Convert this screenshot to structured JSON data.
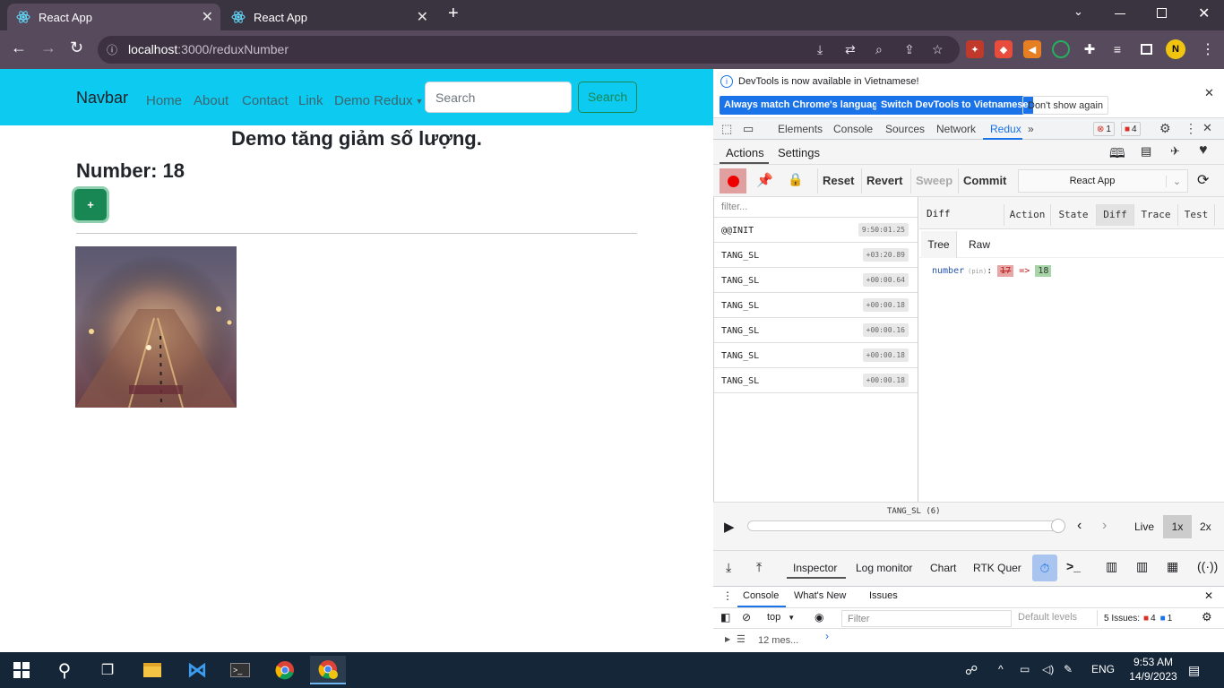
{
  "browser": {
    "tabs": [
      {
        "title": "React App",
        "active": true
      },
      {
        "title": "React App",
        "active": false
      }
    ],
    "url_host": "localhost",
    "url_path": ":3000/reduxNumber"
  },
  "page": {
    "brand": "Navbar",
    "nav_links": [
      "Home",
      "About",
      "Contact",
      "Link"
    ],
    "dropdown_label": "Demo Redux",
    "search_placeholder": "Search",
    "search_button": "Search",
    "heading": "Demo tăng giảm số lượng.",
    "number_label": "Number: 18",
    "plus_label": "+"
  },
  "devtools": {
    "info_message": "DevTools is now available in Vietnamese!",
    "info_buttons": [
      "Always match Chrome's language",
      "Switch DevTools to Vietnamese",
      "Don't show again"
    ],
    "panels": [
      "Elements",
      "Console",
      "Sources",
      "Network",
      "Redux"
    ],
    "error_count": "1",
    "warning_count": "4",
    "redux_tabs": [
      "Actions",
      "Settings"
    ],
    "toolbar_buttons": [
      "Reset",
      "Revert",
      "Sweep",
      "Commit"
    ],
    "instance_select": "React App",
    "filter_placeholder": "filter...",
    "actions": [
      {
        "type": "@@INIT",
        "time": "9:50:01.25"
      },
      {
        "type": "TANG_SL",
        "time": "+03:20.89"
      },
      {
        "type": "TANG_SL",
        "time": "+00:00.64"
      },
      {
        "type": "TANG_SL",
        "time": "+00:00.18"
      },
      {
        "type": "TANG_SL",
        "time": "+00:00.16"
      },
      {
        "type": "TANG_SL",
        "time": "+00:00.18"
      },
      {
        "type": "TANG_SL",
        "time": "+00:00.18"
      }
    ],
    "pane_title": "Diff",
    "pane_tabs": [
      "Action",
      "State",
      "Diff",
      "Trace",
      "Test"
    ],
    "view_tabs": [
      "Tree",
      "Raw"
    ],
    "diff": {
      "key": "number",
      "pin": "(pin)",
      "old": "17",
      "arrow": "=>",
      "new": "18"
    },
    "slider_label": "TANG_SL (6)",
    "speed_buttons": [
      "Live",
      "1x",
      "2x"
    ],
    "monitor_tabs": [
      "Inspector",
      "Log monitor",
      "Chart",
      "RTK Quer"
    ],
    "drawer_tabs": [
      "Console",
      "What's New",
      "Issues"
    ],
    "context": "top",
    "console_filter": "Filter",
    "levels": "Default levels",
    "issues_label": "5 Issues:",
    "issues_errors": "4",
    "issues_info": "1",
    "messages": "12 mes..."
  },
  "taskbar": {
    "lang": "ENG",
    "time": "9:53 AM",
    "date": "14/9/2023"
  },
  "colors": {
    "navbar": "#0dcaf0",
    "success": "#198754",
    "devtools_accent": "#1a73e8",
    "taskbar": "#142637"
  }
}
